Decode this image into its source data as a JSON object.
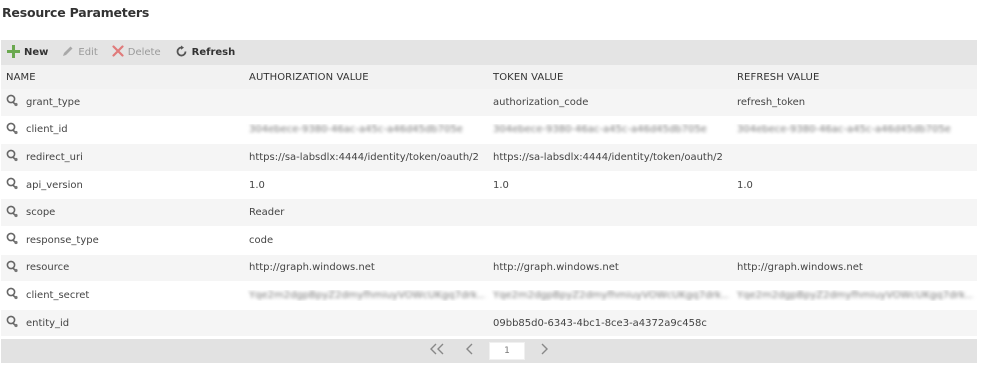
{
  "page": {
    "title": "Resource Parameters"
  },
  "toolbar": {
    "new_label": "New",
    "edit_label": "Edit",
    "delete_label": "Delete",
    "refresh_label": "Refresh"
  },
  "columns": {
    "name": "NAME",
    "authorization": "AUTHORIZATION VALUE",
    "token": "TOKEN VALUE",
    "refresh": "REFRESH VALUE"
  },
  "rows": [
    {
      "name": "grant_type",
      "authorization": "",
      "token": "authorization_code",
      "refresh": "refresh_token",
      "redacted": false
    },
    {
      "name": "client_id",
      "authorization": "304ebece-9380-46ac-a45c-a46d45db705e",
      "token": "304ebece-9380-46ac-a45c-a46d45db705e",
      "refresh": "304ebece-9380-46ac-a45c-a46d45db705e",
      "redacted": true
    },
    {
      "name": "redirect_uri",
      "authorization": "https://sa-labsdlx:4444/identity/token/oauth/2",
      "token": "https://sa-labsdlx:4444/identity/token/oauth/2",
      "refresh": "",
      "redacted": false
    },
    {
      "name": "api_version",
      "authorization": "1.0",
      "token": "1.0",
      "refresh": "1.0",
      "redacted": false
    },
    {
      "name": "scope",
      "authorization": "Reader",
      "token": "",
      "refresh": "",
      "redacted": false
    },
    {
      "name": "response_type",
      "authorization": "code",
      "token": "",
      "refresh": "",
      "redacted": false
    },
    {
      "name": "resource",
      "authorization": "http://graph.windows.net",
      "token": "http://graph.windows.net",
      "refresh": "http://graph.windows.net",
      "redacted": false
    },
    {
      "name": "client_secret",
      "authorization": "Yqe2m2dgpBpyZ2dmyfhmiuyVOWcUKgq7drk...",
      "token": "Yqe2m2dgpBpyZ2dmyfhmiuyVOWcUKgq7drk...",
      "refresh": "Yqe2m2dgpBpyZ2dmyfhmiuyVOWcUKgq7drk...",
      "redacted": true
    },
    {
      "name": "entity_id",
      "authorization": "",
      "token": "09bb85d0-6343-4bc1-8ce3-a4372a9c458c",
      "refresh": "",
      "redacted": false
    }
  ],
  "pager": {
    "page_value": "1"
  },
  "icons": {
    "new": "plus-icon",
    "edit": "pencil-icon",
    "delete": "x-icon",
    "refresh": "refresh-icon",
    "row": "parameter-key-icon",
    "first": "double-chevron-left-icon",
    "prev": "chevron-left-icon",
    "next": "chevron-right-icon"
  },
  "colors": {
    "new_icon": "#6aa84f",
    "delete_icon": "#d9534f",
    "toolbar_bg": "#e4e4e4",
    "pager_bg": "#e2e2e2"
  }
}
